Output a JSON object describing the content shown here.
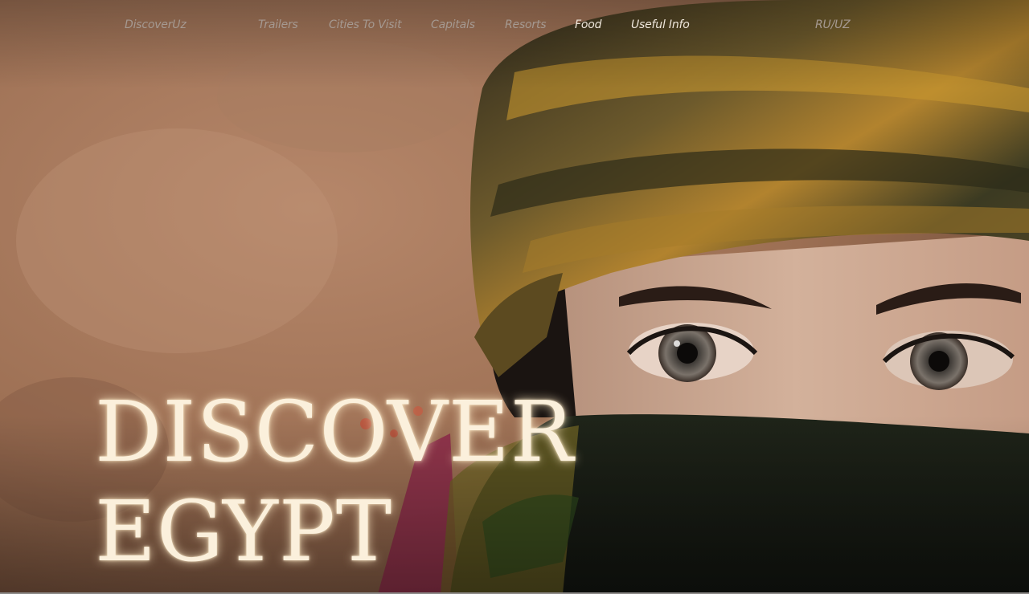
{
  "nav": {
    "brand": "DiscoverUz",
    "links": [
      "Trailers",
      "Cities To Visit",
      "Capitals",
      "Resorts",
      "Food",
      "Useful Info"
    ],
    "lang": "RU/UZ"
  },
  "hero": {
    "line1": "DISCOVER",
    "line2": "EGYPT"
  },
  "colors": {
    "nav_text": "#a59991",
    "nav_active": "#efe7dc",
    "title": "#fbf0dc",
    "wall": "#a87a5c"
  }
}
